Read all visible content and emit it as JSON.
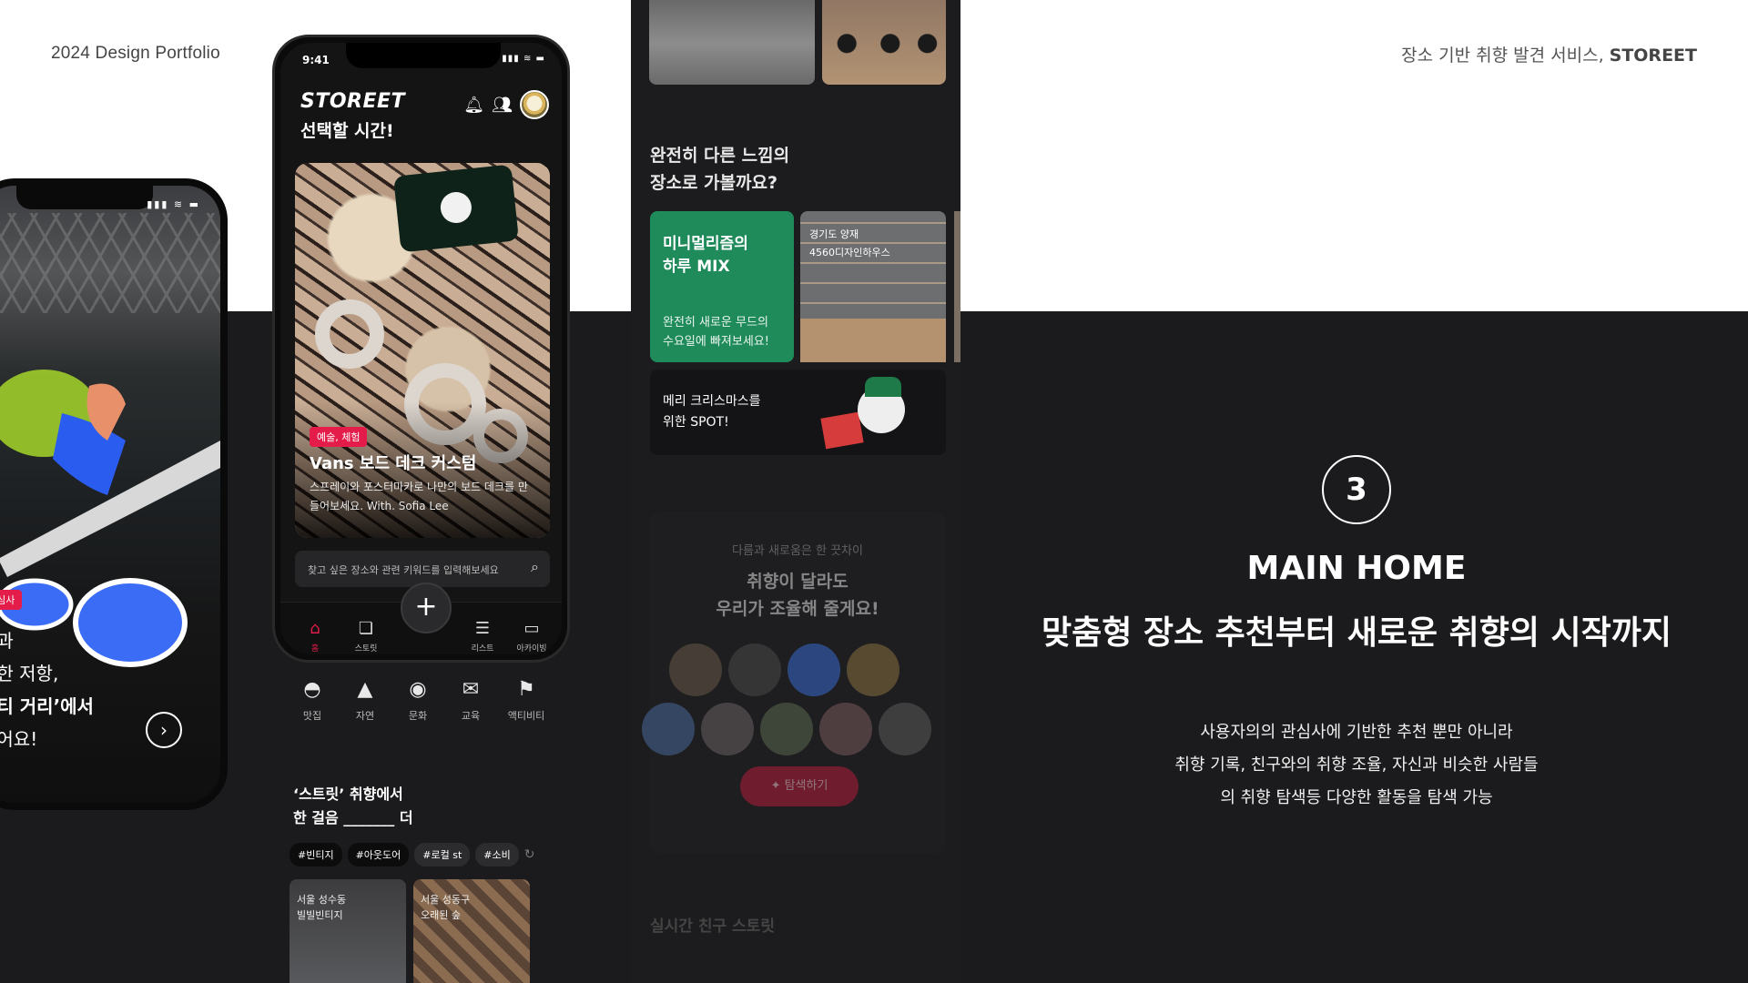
{
  "header": {
    "left": "2024 Design Portfolio",
    "right_prefix": "장소 기반 취향 발견 서비스,",
    "right_brand": "STOREET"
  },
  "left_phone": {
    "tag": "관심사",
    "lines": [
      "심과",
      "위한 저항,",
      "티티 거리’에서",
      "싶어요!"
    ],
    "next_icon": "chevron-right-icon"
  },
  "center_phone": {
    "time": "9:41",
    "logo": "STOREET",
    "subtitle": "선택할 시간!",
    "hero": {
      "pill": "예술, 체험",
      "title": "Vans 보드 데크 커스텀",
      "desc": "스프레이와 포스터마카로 나만의 보드 데크를 만들어보세요. With. Sofia Lee"
    },
    "search_placeholder": "찾고 싶은 장소와 관련 키워드를 입력해보세요",
    "tabs": [
      {
        "label": "홈",
        "icon": "home-icon"
      },
      {
        "label": "스토릿",
        "icon": "cards-icon"
      },
      {
        "label": "리스트",
        "icon": "list-icon"
      },
      {
        "label": "아카이빙",
        "icon": "folder-icon"
      }
    ],
    "fab_icon": "plus-icon"
  },
  "categories": [
    {
      "label": "맛집",
      "icon": "food-icon"
    },
    {
      "label": "자연",
      "icon": "mountain-icon"
    },
    {
      "label": "문화",
      "icon": "vinyl-icon"
    },
    {
      "label": "교육",
      "icon": "school-icon"
    },
    {
      "label": "액티비티",
      "icon": "activity-icon"
    }
  ],
  "street_section": {
    "title_line1": "‘스트릿’ 취향에서",
    "title_line2": "한 걸음 _______ 더",
    "chips": [
      "#빈티지",
      "#아웃도어",
      "#로컬 st",
      "#소비"
    ],
    "cards": [
      {
        "loc": "서울 성수동",
        "name": "빌빌빈티지"
      },
      {
        "loc": "서울 성동구",
        "name": "오래된 숲"
      }
    ]
  },
  "right_screen": {
    "title_line1": "완전히 다른 느낌의",
    "title_line2": "장소로 가볼까요?",
    "green_card": {
      "title_line1": "미니멀리즘의",
      "title_line2": "하루 MIX",
      "desc_line1": "완전히 새로운 무드의",
      "desc_line2": "수요일에 빠져보세요!"
    },
    "room_card": {
      "loc": "경기도 양재",
      "name": "4560디자인하우스"
    },
    "xmas_card": {
      "line1": "메리 크리스마스를",
      "line2": "위한 SPOT!"
    },
    "match": {
      "small": "다름과 새로움은 한 끗차이",
      "line1": "취향이 달라도",
      "line2": "우리가 조율해 줄게요!",
      "cta": "✦ 탐색하기"
    },
    "live_title": "실시간 친구 스토릿"
  },
  "feature": {
    "number": "3",
    "title": "MAIN HOME",
    "subtitle": "맞춤형 장소 추천부터 새로운 취향의 시작까지",
    "desc": [
      "사용자의의 관심사에 기반한 추천 뿐만 아니라",
      "취향 기록, 친구와의 취향 조율, 자신과 비슷한 사람들",
      "의 취향 탐색등 다양한 활동을 탐색 가능"
    ]
  },
  "colors": {
    "accent": "#e31c4a",
    "green": "#1f8a5a",
    "dark_bg": "#1b1b1d"
  }
}
